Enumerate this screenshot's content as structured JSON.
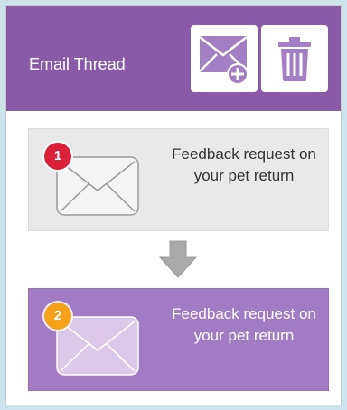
{
  "header": {
    "title": "Email Thread",
    "buttons": [
      {
        "icon": "new-email-icon"
      },
      {
        "icon": "trash-icon"
      }
    ]
  },
  "thread": {
    "items": [
      {
        "number": "1",
        "text": "Feedback request on your pet return",
        "badge_color": "#d9213a"
      },
      {
        "number": "2",
        "text": "Feedback request on your pet return",
        "badge_color": "#f3a21a"
      }
    ],
    "connector_icon": "arrow-down-icon"
  },
  "colors": {
    "header_bg": "#8b5aa6",
    "card_default_bg": "#e9e9e9",
    "card_selected_bg": "#a37bc2"
  }
}
